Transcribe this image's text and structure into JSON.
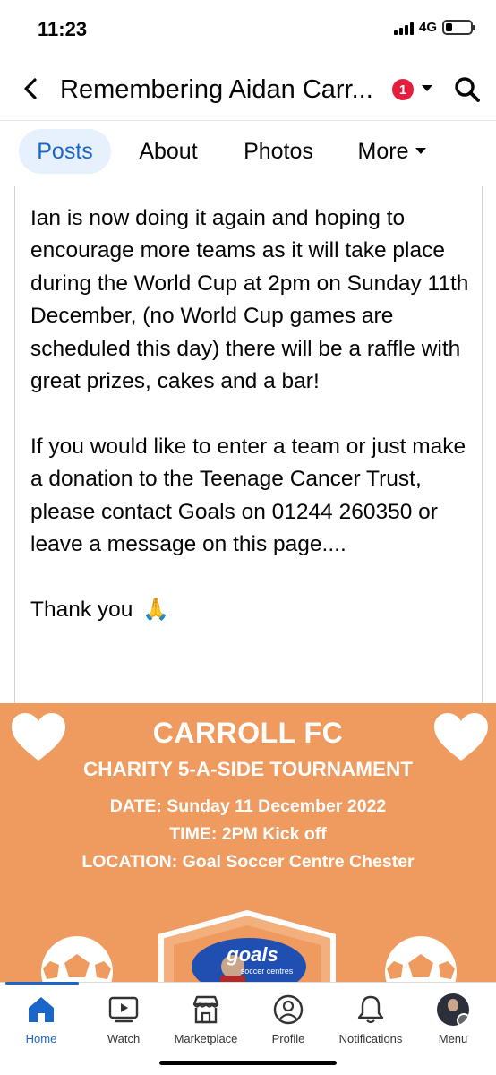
{
  "status_bar": {
    "time": "11:23",
    "network": "4G",
    "battery_level": 0.25
  },
  "header": {
    "title": "Remembering Aidan Carr...",
    "notification_count": "1",
    "icons": [
      "back-icon",
      "caret-down-icon",
      "search-icon"
    ]
  },
  "tabs": [
    {
      "label": "Posts",
      "active": true
    },
    {
      "label": "About",
      "active": false
    },
    {
      "label": "Photos",
      "active": false
    },
    {
      "label": "More",
      "active": false
    }
  ],
  "post": {
    "paragraphs": [
      "Ian is now doing it again and hoping to encourage more teams as it will take place during the World Cup at 2pm on Sunday 11th December, (no World Cup games are scheduled this day) there will be a raffle with great prizes, cakes and a bar!",
      "If you would like to enter a team or just make a donation to the Teenage Cancer Trust, please contact Goals on 01244 260350 or leave a message on this page....",
      "Thank you"
    ],
    "emoji": "🙏"
  },
  "flyer": {
    "title": "CARROLL FC",
    "subtitle": "CHARITY 5-A-SIDE TOURNAMENT",
    "date": "DATE: Sunday 11 December 2022",
    "time": "TIME: 2PM Kick off",
    "location": "LOCATION: Goal Soccer Centre Chester",
    "logo_text": "goals",
    "logo_sub": "soccer centres",
    "background_color": "#ef9a5e"
  },
  "bottom_nav": [
    {
      "label": "Home",
      "icon": "home-icon",
      "active": true
    },
    {
      "label": "Watch",
      "icon": "watch-icon",
      "active": false
    },
    {
      "label": "Marketplace",
      "icon": "marketplace-icon",
      "active": false
    },
    {
      "label": "Profile",
      "icon": "profile-icon",
      "active": false
    },
    {
      "label": "Notifications",
      "icon": "bell-icon",
      "active": false
    },
    {
      "label": "Menu",
      "icon": "avatar-menu-icon",
      "active": false
    }
  ],
  "colors": {
    "accent": "#1b66c9",
    "active_tab_bg": "#e7f0fd",
    "badge": "#e41e3f"
  }
}
